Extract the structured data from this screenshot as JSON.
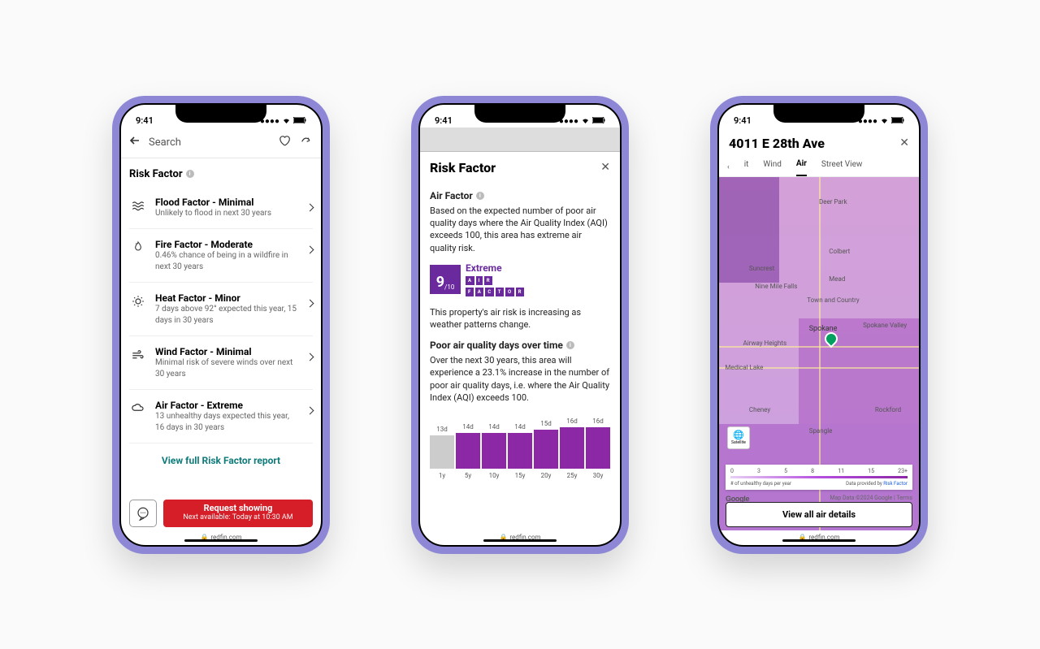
{
  "status": {
    "time": "9:41"
  },
  "url": "redfin.com",
  "phone1": {
    "search_placeholder": "Search",
    "section_title": "Risk Factor",
    "items": [
      {
        "icon": "flood",
        "title": "Flood Factor - Minimal",
        "desc": "Unlikely to flood in next 30 years"
      },
      {
        "icon": "fire",
        "title": "Fire Factor - Moderate",
        "desc": "0.46% chance of being in a wildfire in next 30 years"
      },
      {
        "icon": "heat",
        "title": "Heat Factor - Minor",
        "desc": "7 days above 92° expected this year, 15 days in 30 years"
      },
      {
        "icon": "wind",
        "title": "Wind Factor - Minimal",
        "desc": "Minimal risk of severe winds over next 30 years"
      },
      {
        "icon": "air",
        "title": "Air Factor - Extreme",
        "desc": "13 unhealthy days expected this year, 16 days in 30 years"
      }
    ],
    "link": "View full Risk Factor report",
    "cta_title": "Request showing",
    "cta_sub": "Next available: Today at 10:30 AM"
  },
  "phone2": {
    "title": "Risk Factor",
    "sub1": "Air Factor",
    "desc1": "Based on the expected number of poor air quality days where the Air Quality Index (AQI) exceeds 100, this area has extreme air quality risk.",
    "score": "9",
    "score_den": "/10",
    "score_label": "Extreme",
    "air_factor_text": "AIR FACTOR",
    "desc2": "This property's air risk is increasing as weather patterns change.",
    "sub2": "Poor air quality days over time",
    "desc3": "Over the next 30 years, this area will experience a 23.1% increase in the number of poor air quality days, i.e. where the Air Quality Index (AQI) exceeds 100."
  },
  "chart_data": {
    "type": "bar",
    "categories": [
      "1y",
      "5y",
      "10y",
      "15y",
      "20y",
      "25y",
      "30y"
    ],
    "values": [
      13,
      14,
      14,
      14,
      15,
      16,
      16
    ],
    "labels": [
      "13d",
      "14d",
      "14d",
      "14d",
      "15d",
      "16d",
      "16d"
    ],
    "highlight_first": true,
    "xlabel": "",
    "ylabel": "",
    "title": "",
    "ylim": [
      0,
      17
    ]
  },
  "phone3": {
    "title": "4011 E 28th Ave",
    "tabs": {
      "prev": "it",
      "wind": "Wind",
      "air": "Air",
      "street": "Street View"
    },
    "labels": [
      "Deer Park",
      "Suncrest",
      "Colbert",
      "Nine Mile Falls",
      "Mead",
      "Town and Country",
      "Spokane",
      "Spokane Valley",
      "Airway Heights",
      "Medical Lake",
      "Cheney",
      "Spangle",
      "Rockford"
    ],
    "satellite": "Satellite",
    "legend_ticks": [
      "0",
      "3",
      "5",
      "8",
      "11",
      "15",
      "23+"
    ],
    "legend_left": "# of unhealthy days per year",
    "legend_right_prefix": "Data provided by ",
    "legend_right_link": "Risk Factor",
    "google": "Google",
    "map_attr": "Map Data ©2024 Google",
    "terms": "Terms",
    "view_details": "View all air details"
  }
}
